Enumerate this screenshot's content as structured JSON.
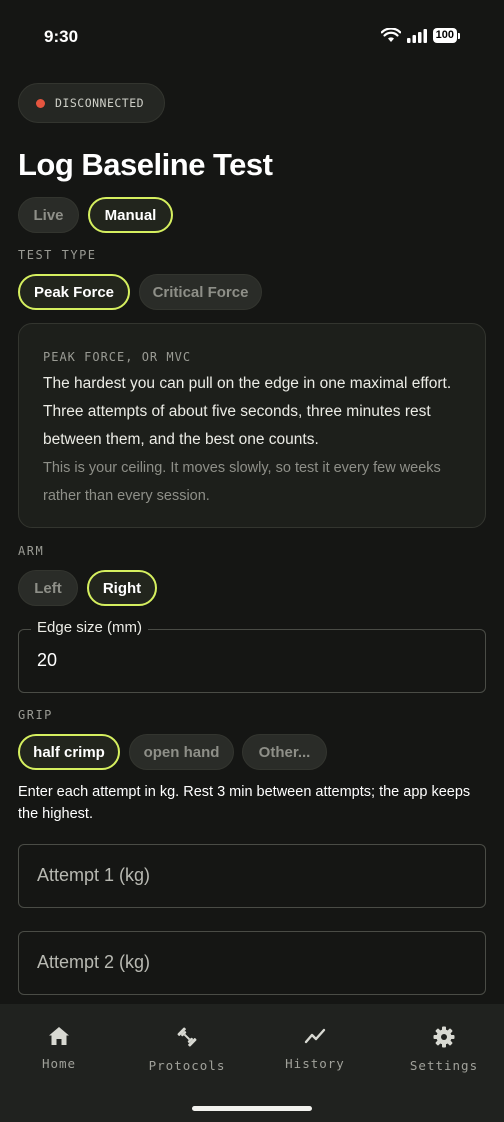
{
  "status_bar": {
    "time": "9:30",
    "battery": "100"
  },
  "connection": {
    "label": "DISCONNECTED",
    "color": "#e5553f"
  },
  "page": {
    "title": "Log Baseline Test"
  },
  "mode_toggle": {
    "options": [
      "Live",
      "Manual"
    ],
    "selected": "Manual"
  },
  "test_type": {
    "label": "TEST TYPE",
    "options": [
      "Peak Force",
      "Critical Force"
    ],
    "selected": "Peak Force"
  },
  "info_card": {
    "heading": "PEAK FORCE, OR MVC",
    "body": "The hardest you can pull on the edge in one maximal effort. Three attempts of about five seconds, three minutes rest between them, and the best one counts.",
    "note": "This is your ceiling. It moves slowly, so test it every few weeks rather than every session."
  },
  "arm": {
    "label": "ARM",
    "options": [
      "Left",
      "Right"
    ],
    "selected": "Right"
  },
  "edge_size": {
    "legend": "Edge size (mm)",
    "value": "20"
  },
  "grip": {
    "label": "GRIP",
    "options": [
      "half crimp",
      "open hand",
      "Other..."
    ],
    "selected": "half crimp"
  },
  "helper_text": "Enter each attempt in kg. Rest 3 min between attempts; the app keeps the highest.",
  "attempts": [
    {
      "placeholder": "Attempt 1 (kg)"
    },
    {
      "placeholder": "Attempt 2 (kg)"
    }
  ],
  "tab_bar": {
    "items": [
      {
        "label": "Home",
        "icon": "home-icon"
      },
      {
        "label": "Protocols",
        "icon": "dumbbell-icon"
      },
      {
        "label": "History",
        "icon": "trend-icon"
      },
      {
        "label": "Settings",
        "icon": "gear-icon"
      }
    ]
  },
  "colors": {
    "accent": "#d5ef5f",
    "background": "#151614"
  }
}
